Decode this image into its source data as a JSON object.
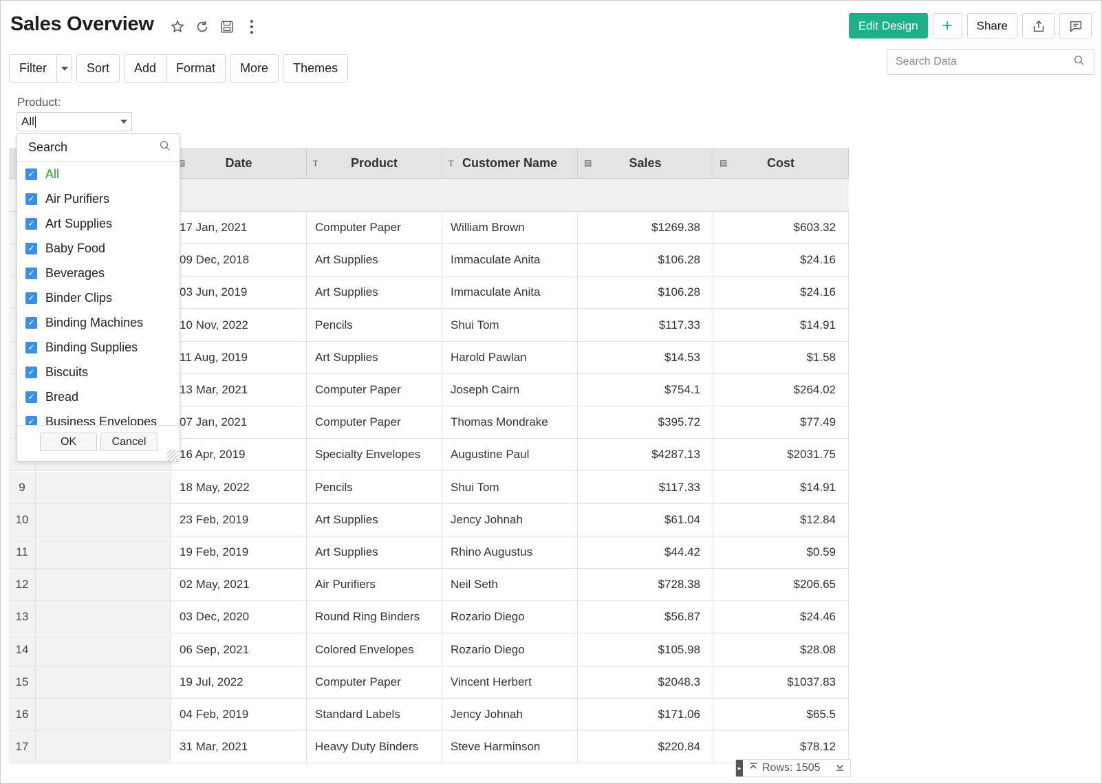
{
  "header": {
    "title": "Sales Overview",
    "icons": [
      "star-icon",
      "refresh-icon",
      "save-icon",
      "more-vertical-icon"
    ]
  },
  "top_actions": {
    "edit_design": "Edit Design",
    "add": "+",
    "share": "Share",
    "export_icon": "export-icon",
    "comment_icon": "comment-icon"
  },
  "search_data": {
    "placeholder": "Search Data"
  },
  "toolbar": {
    "filter": "Filter",
    "sort": "Sort",
    "add": "Add",
    "format": "Format",
    "more": "More",
    "themes": "Themes"
  },
  "product_filter": {
    "label": "Product:",
    "value": "All"
  },
  "dropdown": {
    "search_label": "Search",
    "options": [
      "All",
      "Air Purifiers",
      "Art Supplies",
      "Baby Food",
      "Beverages",
      "Binder Clips",
      "Binding Machines",
      "Binding Supplies",
      "Biscuits",
      "Bread",
      "Business Envelopes"
    ],
    "ok": "OK",
    "cancel": "Cancel"
  },
  "table": {
    "columns": [
      "Date",
      "Product",
      "Customer Name",
      "Sales",
      "Cost"
    ],
    "rows": [
      {
        "idx": "",
        "date": "17 Jan, 2021",
        "product": "Computer Paper",
        "customer": "William Brown",
        "sales": "$1269.38",
        "cost": "$603.32"
      },
      {
        "idx": "",
        "date": "09 Dec, 2018",
        "product": "Art Supplies",
        "customer": "Immaculate Anita",
        "sales": "$106.28",
        "cost": "$24.16"
      },
      {
        "idx": "",
        "date": "03 Jun, 2019",
        "product": "Art Supplies",
        "customer": "Immaculate Anita",
        "sales": "$106.28",
        "cost": "$24.16"
      },
      {
        "idx": "",
        "date": "10 Nov, 2022",
        "product": "Pencils",
        "customer": "Shui Tom",
        "sales": "$117.33",
        "cost": "$14.91"
      },
      {
        "idx": "",
        "date": "11 Aug, 2019",
        "product": "Art Supplies",
        "customer": "Harold Pawlan",
        "sales": "$14.53",
        "cost": "$1.58"
      },
      {
        "idx": "",
        "date": "13 Mar, 2021",
        "product": "Computer Paper",
        "customer": "Joseph Cairn",
        "sales": "$754.1",
        "cost": "$264.02"
      },
      {
        "idx": "",
        "date": "07 Jan, 2021",
        "product": "Computer Paper",
        "customer": "Thomas Mondrake",
        "sales": "$395.72",
        "cost": "$77.49"
      },
      {
        "idx": "",
        "date": "16 Apr, 2019",
        "product": "Specialty Envelopes",
        "customer": "Augustine Paul",
        "sales": "$4287.13",
        "cost": "$2031.75"
      },
      {
        "idx": "9",
        "date": "18 May, 2022",
        "product": "Pencils",
        "customer": "Shui Tom",
        "sales": "$117.33",
        "cost": "$14.91"
      },
      {
        "idx": "10",
        "date": "23 Feb, 2019",
        "product": "Art Supplies",
        "customer": "Jency Johnah",
        "sales": "$61.04",
        "cost": "$12.84"
      },
      {
        "idx": "11",
        "date": "19 Feb, 2019",
        "product": "Art Supplies",
        "customer": "Rhino Augustus",
        "sales": "$44.42",
        "cost": "$0.59"
      },
      {
        "idx": "12",
        "date": "02 May, 2021",
        "product": "Air Purifiers",
        "customer": "Neil Seth",
        "sales": "$728.38",
        "cost": "$206.65"
      },
      {
        "idx": "13",
        "date": "03 Dec, 2020",
        "product": "Round Ring Binders",
        "customer": "Rozario Diego",
        "sales": "$56.87",
        "cost": "$24.46"
      },
      {
        "idx": "14",
        "date": "06 Sep, 2021",
        "product": "Colored Envelopes",
        "customer": "Rozario Diego",
        "sales": "$105.98",
        "cost": "$28.08"
      },
      {
        "idx": "15",
        "date": "19 Jul, 2022",
        "product": "Computer Paper",
        "customer": "Vincent Herbert",
        "sales": "$2048.3",
        "cost": "$1037.83"
      },
      {
        "idx": "16",
        "date": "04 Feb, 2019",
        "product": "Standard Labels",
        "customer": "Jency Johnah",
        "sales": "$171.06",
        "cost": "$65.5"
      },
      {
        "idx": "17",
        "date": "31 Mar, 2021",
        "product": "Heavy Duty Binders",
        "customer": "Steve Harminson",
        "sales": "$220.84",
        "cost": "$78.12"
      }
    ]
  },
  "footer": {
    "rows_label": "Rows: 1505"
  },
  "colors": {
    "accent": "#20b089",
    "checkbox": "#3a8ee6",
    "all_option": "#2e9a2e"
  }
}
